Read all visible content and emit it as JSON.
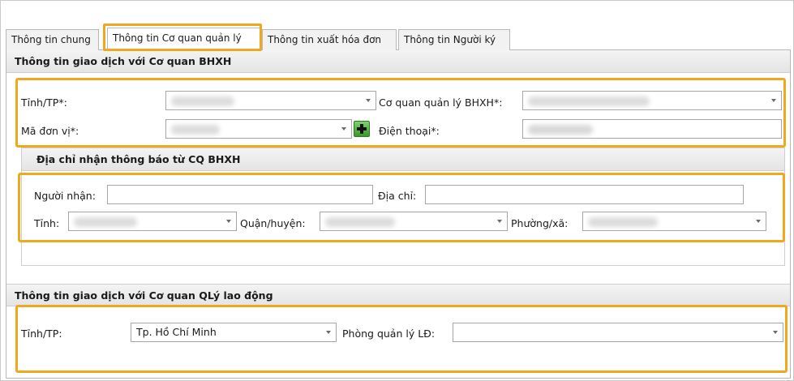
{
  "tabs": [
    {
      "label": "Thông tin chung"
    },
    {
      "label": "Thông tin Cơ quan quản lý"
    },
    {
      "label": "Thông tin xuất hóa đơn"
    },
    {
      "label": "Thông tin Người ký"
    }
  ],
  "active_tab": "Thông tin Cơ quan quản lý",
  "bhxh_section": {
    "title": "Thông tin giao dịch với Cơ quan BHXH",
    "province_label": "Tỉnh/TP*:",
    "agency_label": "Cơ quan quản lý BHXH*:",
    "unit_code_label": "Mã đơn vị*:",
    "phone_label": "Điện thoại*:"
  },
  "notice_address": {
    "title": "Địa chỉ nhận thông báo từ CQ BHXH",
    "recipient_label": "Người nhận:",
    "address_label": "Địa chỉ:",
    "province_label": "Tỉnh:",
    "district_label": "Quận/huyện:",
    "ward_label": "Phường/xã:"
  },
  "labor_section": {
    "title": "Thông tin giao dịch với Cơ quan QLý lao động",
    "province_label": "Tỉnh/TP:",
    "province_value": "Tp. Hồ Chí Minh",
    "office_label": "Phòng quản lý LĐ:"
  },
  "colors": {
    "highlight": "#f0a820",
    "add_button": "#4caf3a"
  },
  "icons": [
    "dropdown-arrow-icon",
    "plus-icon"
  ]
}
